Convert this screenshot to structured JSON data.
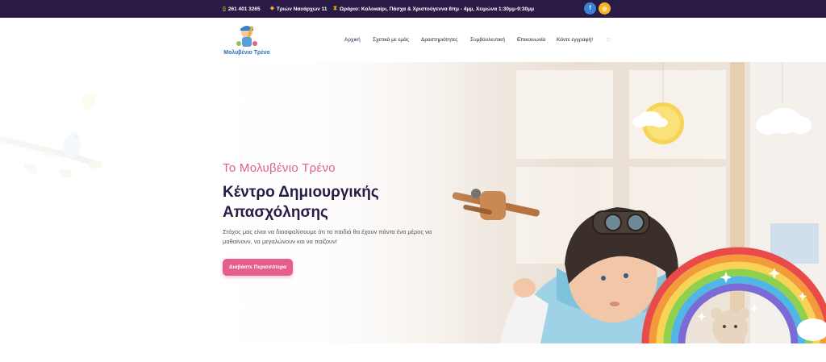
{
  "topbar": {
    "phone_icon": "phone-icon",
    "phone": "261 401 3265",
    "address_icon": "map-pin-icon",
    "address": "Τριών Ναυάρχων 11",
    "hours_icon": "hourglass-icon",
    "hours": "Ωράριο: Καλοκαίρι, Πάσχα & Χριστούγεννα 8πμ - 4μμ, Χειμώνα 1:30μμ-9:30μμ",
    "social": [
      {
        "icon": "facebook-icon",
        "glyph": "f",
        "color": "#3b82d6"
      },
      {
        "icon": "instagram-icon",
        "glyph": "◎",
        "color": "#f5b52a"
      }
    ]
  },
  "header": {
    "logo_text": "Μολυβένιο Τρένο",
    "nav": [
      {
        "label": "Αρχική"
      },
      {
        "label": "Σχετικά με εμάς"
      },
      {
        "label": "Δραστηριότητες"
      },
      {
        "label": "Συμβουλευτική"
      },
      {
        "label": "Επικοινωνία"
      },
      {
        "label": "Κάντε εγγραφή!"
      }
    ],
    "cart_icon": "heart-icon"
  },
  "hero": {
    "subtitle": "Το Μολυβένιο Τρένο",
    "headline_line1": "Κέντρο Δημιουργικής",
    "headline_line2": "Απασχόλησης",
    "description": "Στόχος μας είναι να διασφαλίσουμε ότι τα παιδιά θα έχουν πάντα ένα μέρος να μαθαίνουν, να μεγαλώνουν και να παίζουν!",
    "cta_label": "Διαβάστε Περισσότερα"
  },
  "colors": {
    "topbar_bg": "#2a1a46",
    "accent_pink": "#e65f8c",
    "accent_yellow": "#f5b52a",
    "heading": "#2a1a46"
  }
}
